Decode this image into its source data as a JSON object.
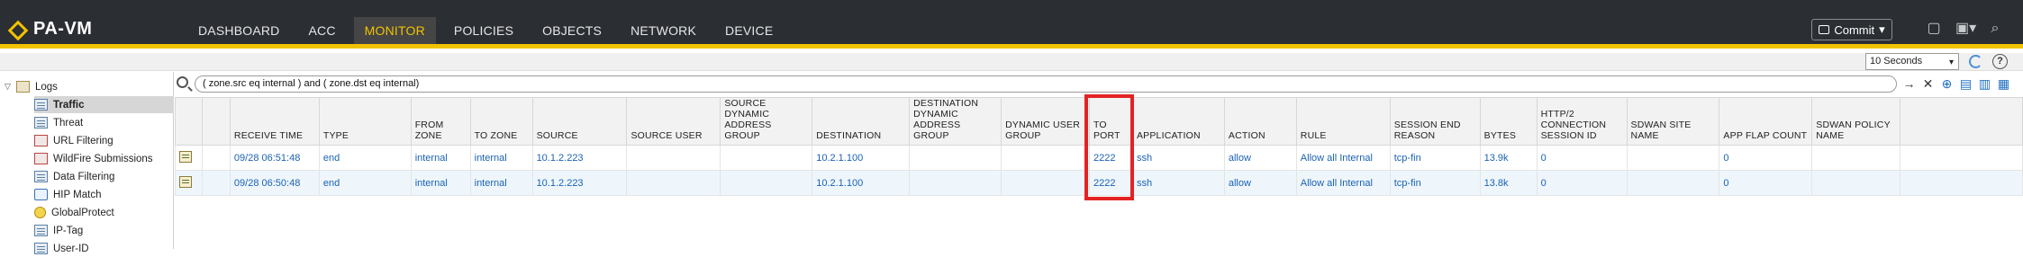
{
  "app": {
    "logo_text": "PA-VM",
    "accent": "#f2c200",
    "highlight_color": "#e32323"
  },
  "nav": {
    "tabs": [
      {
        "label": "DASHBOARD"
      },
      {
        "label": "ACC"
      },
      {
        "label": "MONITOR",
        "active": true
      },
      {
        "label": "POLICIES"
      },
      {
        "label": "OBJECTS"
      },
      {
        "label": "NETWORK"
      },
      {
        "label": "DEVICE"
      }
    ],
    "commit_label": "Commit",
    "right_icons": [
      "task-icon",
      "save-config-icon",
      "search-icon"
    ]
  },
  "refresh": {
    "interval": "10 Seconds",
    "help": "?"
  },
  "sidebar": {
    "items": [
      {
        "label": "Logs",
        "icon": "logs-folder-icon",
        "expander": "▽"
      },
      {
        "label": "Traffic",
        "icon": "document-icon",
        "selected": true
      },
      {
        "label": "Threat",
        "icon": "document-icon"
      },
      {
        "label": "URL Filtering",
        "icon": "document-icon"
      },
      {
        "label": "WildFire Submissions",
        "icon": "document-icon"
      },
      {
        "label": "Data Filtering",
        "icon": "document-icon"
      },
      {
        "label": "HIP Match",
        "icon": "hip-icon"
      },
      {
        "label": "GlobalProtect",
        "icon": "globe-icon"
      },
      {
        "label": "IP-Tag",
        "icon": "document-icon"
      },
      {
        "label": "User-ID",
        "icon": "document-icon"
      }
    ]
  },
  "filter": {
    "query": "( zone.src eq internal ) and ( zone.dst eq internal)"
  },
  "table": {
    "columns": [
      "",
      "",
      "RECEIVE TIME",
      "TYPE",
      "FROM ZONE",
      "TO ZONE",
      "SOURCE",
      "SOURCE USER",
      "SOURCE DYNAMIC ADDRESS GROUP",
      "DESTINATION",
      "DESTINATION DYNAMIC ADDRESS GROUP",
      "DYNAMIC USER GROUP",
      "TO PORT",
      "APPLICATION",
      "ACTION",
      "RULE",
      "SESSION END REASON",
      "BYTES",
      "HTTP/2 CONNECTION SESSION ID",
      "SDWAN SITE NAME",
      "APP FLAP COUNT",
      "SDWAN POLICY NAME",
      ""
    ],
    "rows": [
      [
        "",
        "",
        "09/28 06:51:48",
        "end",
        "internal",
        "internal",
        "10.1.2.223",
        "",
        "",
        "10.2.1.100",
        "",
        "",
        "2222",
        "ssh",
        "allow",
        "Allow all Internal",
        "tcp-fin",
        "13.9k",
        "0",
        "",
        "0",
        "",
        ""
      ],
      [
        "",
        "",
        "09/28 06:50:48",
        "end",
        "internal",
        "internal",
        "10.1.2.223",
        "",
        "",
        "10.2.1.100",
        "",
        "",
        "2222",
        "ssh",
        "allow",
        "Allow all Internal",
        "tcp-fin",
        "13.8k",
        "0",
        "",
        "0",
        "",
        ""
      ]
    ]
  }
}
